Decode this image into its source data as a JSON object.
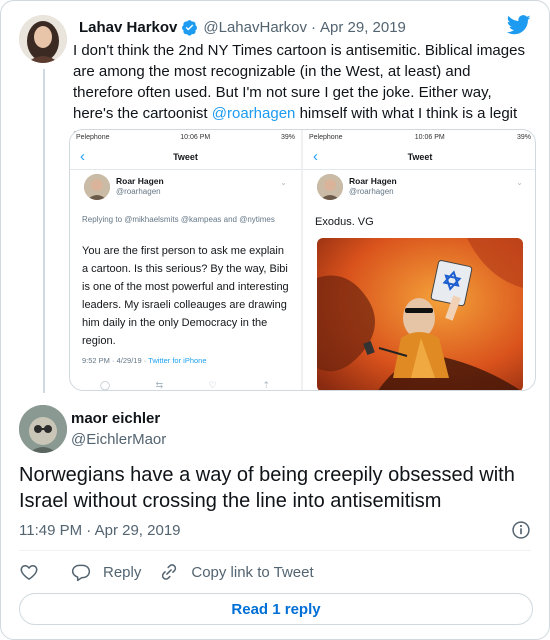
{
  "parent_tweet": {
    "name": "Lahav Harkov",
    "handle": "@LahavHarkov",
    "separator": "·",
    "date": "Apr 29, 2019",
    "text_before_mention": "I don't think the 2nd NY Times cartoon is antisemitic. Biblical images are among the most recognizable (in the West, at least) and therefore often used. But I'm not sure I get the joke. Either way, here's the cartoonist ",
    "mention": "@roarhagen",
    "text_after_mention": " himself with what I think is a legit statement.",
    "verified_icon": "verified-badge-icon",
    "logo_icon": "twitter-bird-icon",
    "accent_color": "#1d9bf0"
  },
  "media": {
    "left_screenshot": {
      "carrier": "Pelephone",
      "time": "10:06 PM",
      "battery": "39%",
      "nav_title": "Tweet",
      "back_glyph": "‹",
      "author_name": "Roar Hagen",
      "author_handle": "@roarhagen",
      "replying_to": "Replying to @mikhaelsmits @kampeas and @nytimes",
      "body": "You are the first person to ask me explain a cartoon. Is this serious? By the way, Bibi is one of the most powerful and interesting leaders. My israeli colleauges are drawing him daily in the only Democracy in the region.",
      "timestamp": "9:52 PM · 4/29/19 · ",
      "via": "Twitter for iPhone"
    },
    "right_screenshot": {
      "carrier": "Pelephone",
      "time": "10:06 PM",
      "battery": "39%",
      "nav_title": "Tweet",
      "back_glyph": "‹",
      "author_name": "Roar Hagen",
      "author_handle": "@roarhagen",
      "caption": "Exodus. VG"
    }
  },
  "reply_tweet": {
    "name": "maor eichler",
    "handle": "@EichlerMaor",
    "text": "Norwegians have a way of being creepily obsessed with Israel without crossing the line into antisemitism",
    "time": "11:49 PM",
    "separator": "·",
    "date": "Apr 29, 2019"
  },
  "actions": {
    "like_icon": "heart-icon",
    "reply_label": "Reply",
    "copy_label": "Copy link to Tweet",
    "read_replies_label": "Read 1 reply"
  }
}
